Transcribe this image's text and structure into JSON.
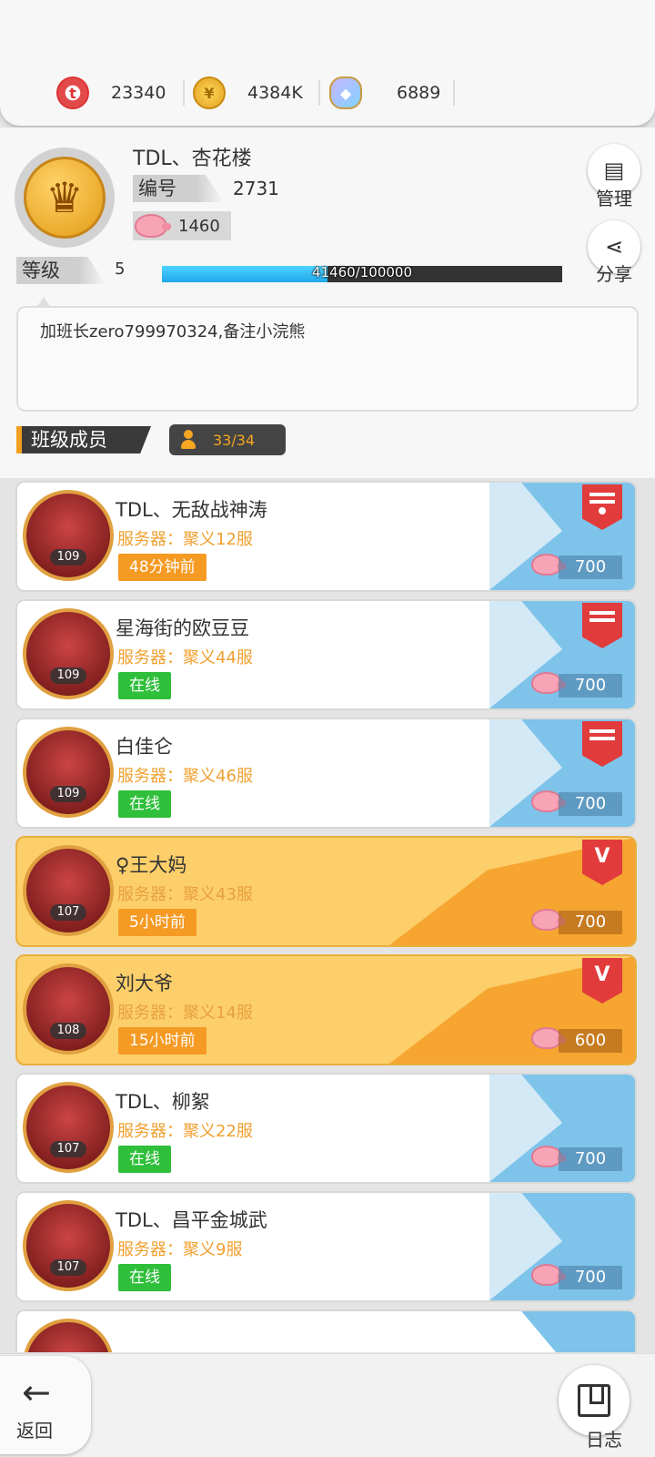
{
  "currencies": [
    {
      "icon": "red-token-icon",
      "glyph": "t",
      "value": "23340"
    },
    {
      "icon": "gold-coin-icon",
      "glyph": "¥",
      "value": "4384K"
    },
    {
      "icon": "crystal-pendant-icon",
      "glyph": "◆",
      "value": "6889"
    }
  ],
  "club": {
    "name": "TDL、杏花楼",
    "id_label": "编号",
    "id_value": "2731",
    "funds": "1460",
    "level_label": "等级",
    "level_value": "5",
    "progress_text": "41460/100000",
    "progress_fraction": 0.4146,
    "notice": "加班长zero799970324,备注小浣熊",
    "manage_label": "管理",
    "share_label": "分享"
  },
  "members_section": {
    "title": "班级成员",
    "count": "33/34"
  },
  "members": [
    {
      "name": "TDL、无敌战神涛",
      "server": "服务器：聚义12服",
      "status": "48分钟前",
      "online": false,
      "level": "109",
      "contrib": "700",
      "gold": false,
      "badge": "captain"
    },
    {
      "name": "星海街的欧豆豆",
      "server": "服务器：聚义44服",
      "status": "在线",
      "online": true,
      "level": "109",
      "contrib": "700",
      "gold": false,
      "badge": "officer"
    },
    {
      "name": "白佳仑",
      "server": "服务器：聚义46服",
      "status": "在线",
      "online": true,
      "level": "109",
      "contrib": "700",
      "gold": false,
      "badge": "officer"
    },
    {
      "name": "♀王大妈",
      "server": "服务器：聚义43服",
      "status": "5小时前",
      "online": false,
      "level": "107",
      "contrib": "700",
      "gold": true,
      "badge": "v"
    },
    {
      "name": "刘大爷",
      "server": "服务器：聚义14服",
      "status": "15小时前",
      "online": false,
      "level": "108",
      "contrib": "600",
      "gold": true,
      "badge": "v"
    },
    {
      "name": "TDL、柳絮",
      "server": "服务器：聚义22服",
      "status": "在线",
      "online": true,
      "level": "107",
      "contrib": "700",
      "gold": false,
      "badge": ""
    },
    {
      "name": "TDL、昌平金城武",
      "server": "服务器：聚义9服",
      "status": "在线",
      "online": true,
      "level": "107",
      "contrib": "700",
      "gold": false,
      "badge": ""
    }
  ],
  "nav": {
    "back_label": "返回",
    "log_label": "日志"
  },
  "colors": {
    "online": "#2fbf3a",
    "offline": "#f59a23",
    "progress": "#1ea8ea",
    "accent_orange": "#f0a020"
  }
}
